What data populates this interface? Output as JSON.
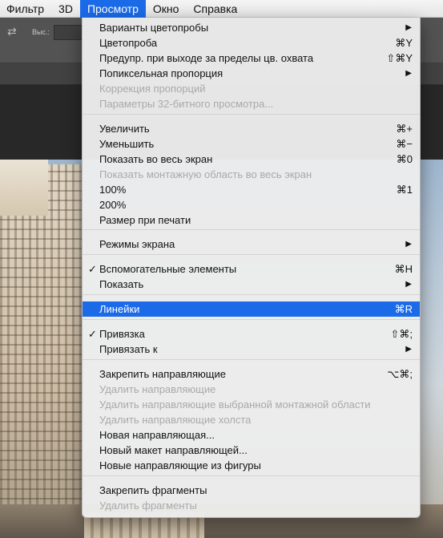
{
  "menubar": {
    "items": [
      {
        "label": "Фильтр"
      },
      {
        "label": "3D"
      },
      {
        "label": "Просмотр"
      },
      {
        "label": "Окно"
      },
      {
        "label": "Справка"
      }
    ]
  },
  "optionsbar": {
    "height_label": "Выс.:",
    "swap_icon": "⇄"
  },
  "menu": {
    "submenu_glyph": "▶",
    "check_glyph": "✓",
    "items": [
      {
        "label": "Варианты цветопробы",
        "shortcut": "",
        "submenu": true,
        "disabled": false,
        "checked": false
      },
      {
        "label": "Цветопроба",
        "shortcut": "⌘Y",
        "submenu": false,
        "disabled": false,
        "checked": false
      },
      {
        "label": "Предупр. при выходе за пределы цв. охвата",
        "shortcut": "⇧⌘Y",
        "submenu": false,
        "disabled": false,
        "checked": false
      },
      {
        "label": "Попиксельная пропорция",
        "shortcut": "",
        "submenu": true,
        "disabled": false,
        "checked": false
      },
      {
        "label": "Коррекция пропорций",
        "shortcut": "",
        "submenu": false,
        "disabled": true,
        "checked": false
      },
      {
        "label": "Параметры 32-битного просмотра...",
        "shortcut": "",
        "submenu": false,
        "disabled": true,
        "checked": false
      },
      {
        "label": "Увеличить",
        "shortcut": "⌘+",
        "submenu": false,
        "disabled": false,
        "checked": false
      },
      {
        "label": "Уменьшить",
        "shortcut": "⌘−",
        "submenu": false,
        "disabled": false,
        "checked": false
      },
      {
        "label": "Показать во весь экран",
        "shortcut": "⌘0",
        "submenu": false,
        "disabled": false,
        "checked": false
      },
      {
        "label": "Показать монтажную область во весь экран",
        "shortcut": "",
        "submenu": false,
        "disabled": true,
        "checked": false
      },
      {
        "label": "100%",
        "shortcut": "⌘1",
        "submenu": false,
        "disabled": false,
        "checked": false
      },
      {
        "label": "200%",
        "shortcut": "",
        "submenu": false,
        "disabled": false,
        "checked": false
      },
      {
        "label": "Размер при печати",
        "shortcut": "",
        "submenu": false,
        "disabled": false,
        "checked": false
      },
      {
        "label": "Режимы экрана",
        "shortcut": "",
        "submenu": true,
        "disabled": false,
        "checked": false
      },
      {
        "label": "Вспомогательные элементы",
        "shortcut": "⌘H",
        "submenu": false,
        "disabled": false,
        "checked": true
      },
      {
        "label": "Показать",
        "shortcut": "",
        "submenu": true,
        "disabled": false,
        "checked": false
      },
      {
        "label": "Линейки",
        "shortcut": "⌘R",
        "submenu": false,
        "disabled": false,
        "checked": false,
        "highlighted": true
      },
      {
        "label": "Привязка",
        "shortcut": "⇧⌘;",
        "submenu": false,
        "disabled": false,
        "checked": true
      },
      {
        "label": "Привязать к",
        "shortcut": "",
        "submenu": true,
        "disabled": false,
        "checked": false
      },
      {
        "label": "Закрепить направляющие",
        "shortcut": "⌥⌘;",
        "submenu": false,
        "disabled": false,
        "checked": false
      },
      {
        "label": "Удалить направляющие",
        "shortcut": "",
        "submenu": false,
        "disabled": true,
        "checked": false
      },
      {
        "label": "Удалить направляющие выбранной монтажной области",
        "shortcut": "",
        "submenu": false,
        "disabled": true,
        "checked": false
      },
      {
        "label": "Удалить направляющие холста",
        "shortcut": "",
        "submenu": false,
        "disabled": true,
        "checked": false
      },
      {
        "label": "Новая направляющая...",
        "shortcut": "",
        "submenu": false,
        "disabled": false,
        "checked": false
      },
      {
        "label": "Новый макет направляющей...",
        "shortcut": "",
        "submenu": false,
        "disabled": false,
        "checked": false
      },
      {
        "label": "Новые направляющие из фигуры",
        "shortcut": "",
        "submenu": false,
        "disabled": false,
        "checked": false
      },
      {
        "label": "Закрепить фрагменты",
        "shortcut": "",
        "submenu": false,
        "disabled": false,
        "checked": false
      },
      {
        "label": "Удалить фрагменты",
        "shortcut": "",
        "submenu": false,
        "disabled": true,
        "checked": false
      }
    ]
  },
  "colors": {
    "highlight": "#1b6be8",
    "disabled_text": "#a9a9a9",
    "menu_bg": "#ececec"
  }
}
